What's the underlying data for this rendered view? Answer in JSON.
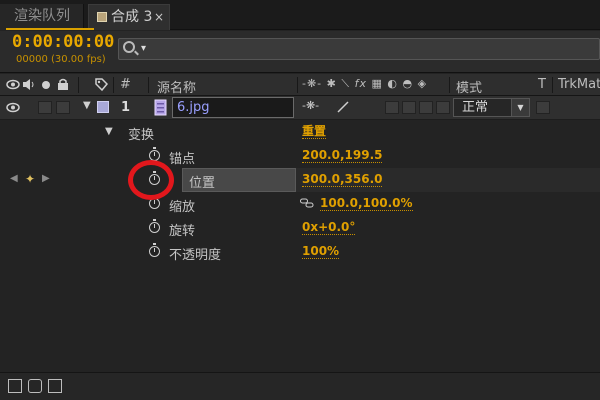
{
  "tabs": [
    {
      "label": "渲染队列",
      "active": false
    },
    {
      "label": "合成 3",
      "active": true,
      "close": "×"
    }
  ],
  "timecode": "0:00:00:00",
  "frame_info": "00000 (30.00 fps)",
  "search": {
    "placeholder": "",
    "dropdown_arrow": "▾"
  },
  "header": {
    "number_col": "#",
    "source_name": "源名称",
    "mode": "模式",
    "t_col": "T",
    "trkmat": "TrkMat"
  },
  "layer": {
    "number": "1",
    "name": "6.jpg",
    "mode": "正常"
  },
  "transform": {
    "label": "变换",
    "reset": "重置",
    "properties": [
      {
        "label": "锚点",
        "value": "200.0,199.5"
      },
      {
        "label": "位置",
        "value": "300.0,356.0"
      },
      {
        "label": "缩放",
        "value": "100.0,100.0%"
      },
      {
        "label": "旋转",
        "value": "0x+0.0°"
      },
      {
        "label": "不透明度",
        "value": "100%"
      }
    ]
  },
  "colors": {
    "accent": "#e0a000",
    "annotation": "#e2171c",
    "layer_label": "#a8a8d8"
  },
  "icons": [
    "eye-icon",
    "audio-icon",
    "solo-icon",
    "lock-icon",
    "label-tag-icon",
    "stopwatch-icon",
    "keyframe-nav-icon",
    "link-icon",
    "fx-icon",
    "motion-blur-icon",
    "3d-layer-icon"
  ]
}
